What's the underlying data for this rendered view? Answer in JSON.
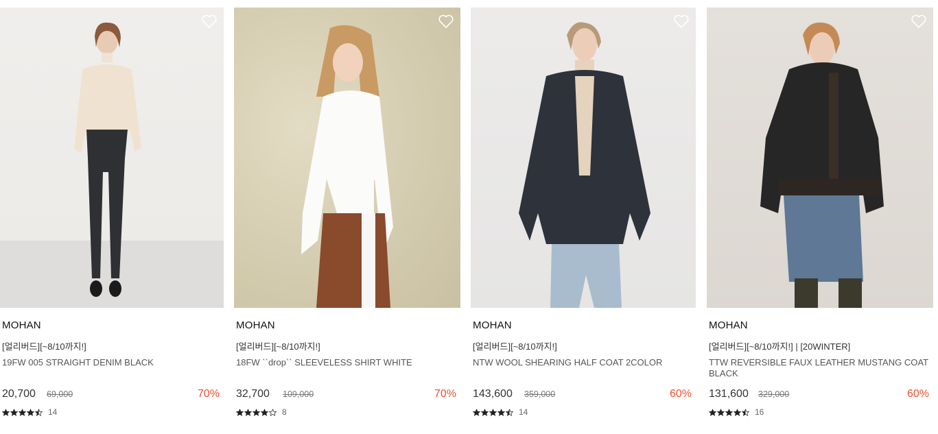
{
  "products": [
    {
      "brand": "MOHAN",
      "promo": "[얼리버드][~8/10까지!]",
      "name": "19FW 005 STRAIGHT DENIM BLACK",
      "price": "20,700",
      "original_price": "69,000",
      "discount": "70%",
      "rating": 4.5,
      "review_count": "14"
    },
    {
      "brand": "MOHAN",
      "promo": "[얼리버드][~8/10까지!]",
      "name": "18FW ``drop`` SLEEVELESS SHIRT WHITE",
      "price": "32,700",
      "original_price": "109,000",
      "discount": "70%",
      "rating": 4,
      "review_count": "8"
    },
    {
      "brand": "MOHAN",
      "promo": "[얼리버드][~8/10까지!]",
      "name": "NTW WOOL SHEARING HALF COAT 2COLOR",
      "price": "143,600",
      "original_price": "359,000",
      "discount": "60%",
      "rating": 4.5,
      "review_count": "14"
    },
    {
      "brand": "MOHAN",
      "promo": "[얼리버드][~8/10까지!] | [20WINTER]",
      "name": "TTW REVERSIBLE FAUX LEATHER MUSTANG COAT BLACK",
      "price": "131,600",
      "original_price": "329,000",
      "discount": "60%",
      "rating": 4.5,
      "review_count": "16"
    }
  ],
  "colors": {
    "discount": "#e8502f",
    "star": "#222222",
    "wishlist_icon": "#ffffff"
  },
  "icons": {
    "wishlist": "heart-outline-icon",
    "star_full": "star-icon",
    "star_half": "star-half-icon",
    "star_empty": "star-empty-icon"
  }
}
